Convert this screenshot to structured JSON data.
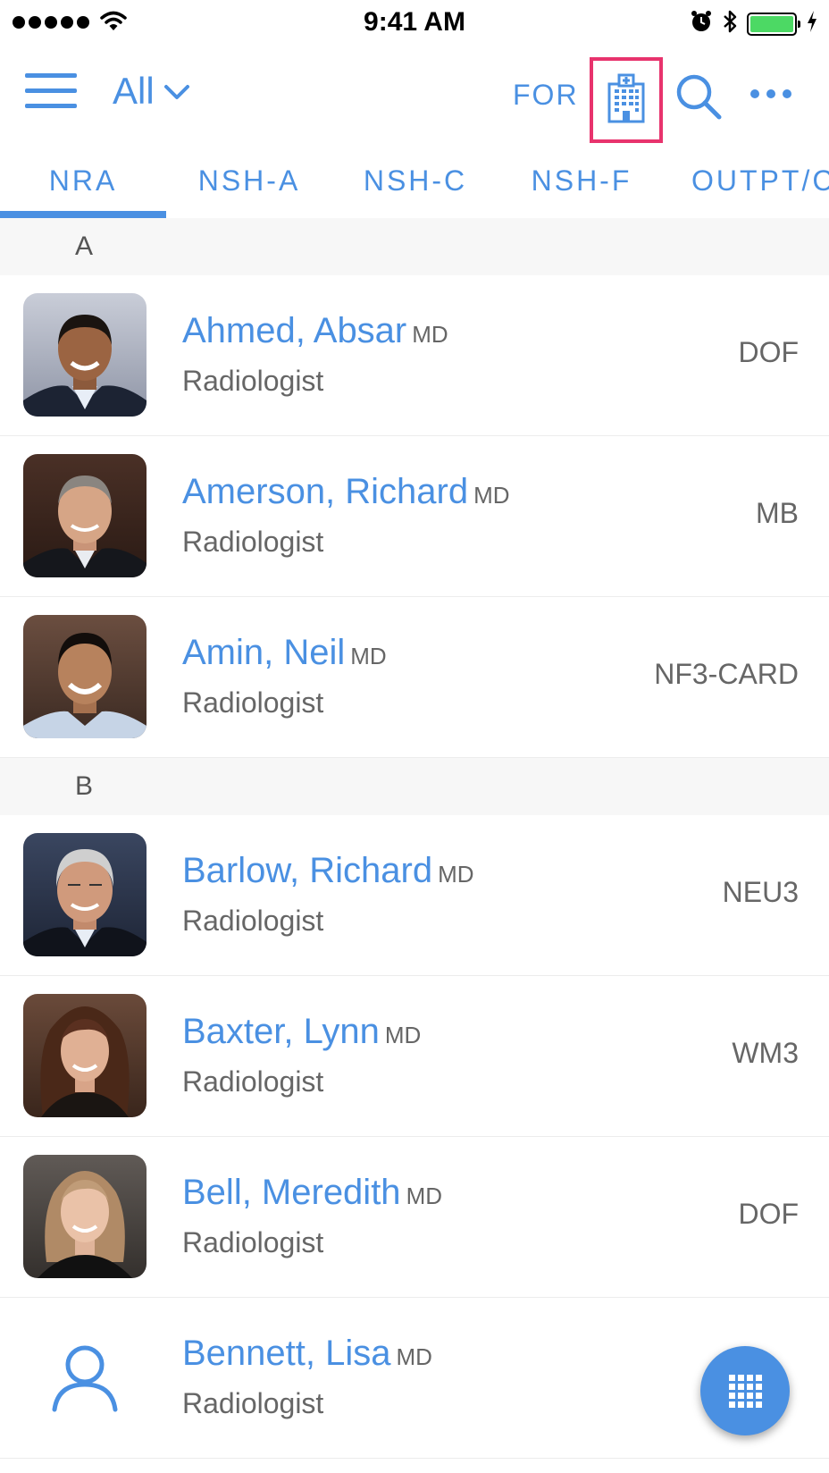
{
  "status_bar": {
    "time": "9:41 AM"
  },
  "header": {
    "filter_label": "All",
    "for_label": "FOR"
  },
  "tabs": [
    "NRA",
    "NSH-A",
    "NSH-C",
    "NSH-F",
    "OUTPT/C"
  ],
  "sections": [
    {
      "letter": "A",
      "people": [
        {
          "name": "Ahmed, Absar",
          "credential": "MD",
          "title": "Radiologist",
          "location": "DOF"
        },
        {
          "name": "Amerson, Richard",
          "credential": "MD",
          "title": "Radiologist",
          "location": "MB"
        },
        {
          "name": "Amin, Neil",
          "credential": "MD",
          "title": "Radiologist",
          "location": "NF3-CARD"
        }
      ]
    },
    {
      "letter": "B",
      "people": [
        {
          "name": "Barlow, Richard",
          "credential": "MD",
          "title": "Radiologist",
          "location": "NEU3"
        },
        {
          "name": "Baxter, Lynn",
          "credential": "MD",
          "title": "Radiologist",
          "location": "WM3"
        },
        {
          "name": "Bell, Meredith",
          "credential": "MD",
          "title": "Radiologist",
          "location": "DOF"
        },
        {
          "name": "Bennett, Lisa",
          "credential": "MD",
          "title": "Radiologist",
          "location": ""
        }
      ]
    }
  ],
  "colors": {
    "accent": "#4a90e2",
    "highlight": "#e8336d"
  }
}
